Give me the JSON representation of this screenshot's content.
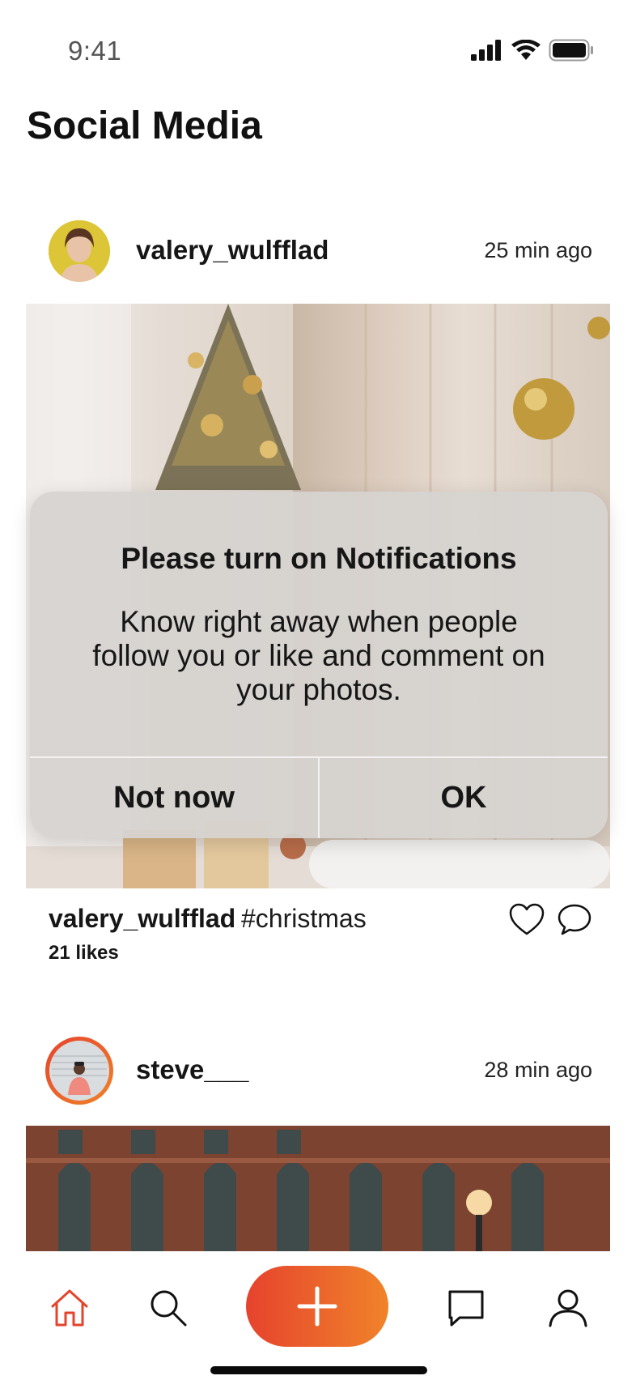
{
  "status_bar": {
    "time": "9:41"
  },
  "header": {
    "title": "Social Media"
  },
  "posts": [
    {
      "username": "valery_wulfflad",
      "time_ago": "25 min ago",
      "caption_user": "valery_wulfflad",
      "caption_tag": "#christmas",
      "likes": "21 likes"
    },
    {
      "username": "steve___",
      "time_ago": "28 min ago"
    }
  ],
  "dialog": {
    "title": "Please turn on Notifications",
    "body": "Know right away when people follow you or like and comment on your photos.",
    "cancel_label": "Not now",
    "ok_label": "OK"
  },
  "nav": {
    "items": [
      "home-icon",
      "search-icon",
      "add-icon",
      "chat-icon",
      "profile-icon"
    ],
    "active_color": "#e6432d",
    "fab_gradient": [
      "#e6432d",
      "#f0832a"
    ]
  }
}
